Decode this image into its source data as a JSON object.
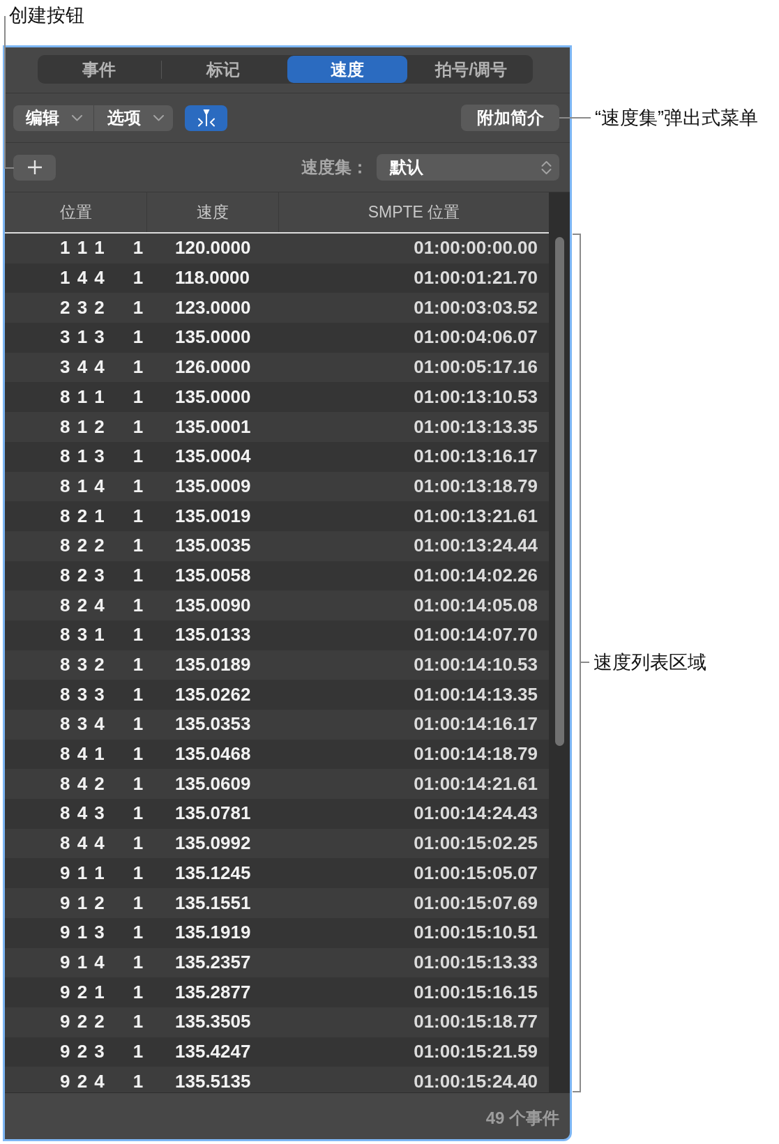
{
  "annotations": [
    {
      "kind": "elbow",
      "text": "创建按钮"
    },
    {
      "kind": "line",
      "text": "“速度集”弹出式菜单"
    },
    {
      "kind": "bracket",
      "text": "速度列表区域"
    }
  ],
  "tabs": [
    {
      "label": "事件",
      "selected": false
    },
    {
      "label": "标记",
      "selected": false
    },
    {
      "label": "速度",
      "selected": true
    },
    {
      "label": "拍号/调号",
      "selected": false
    }
  ],
  "toolbar": {
    "menus": [
      {
        "label": "编辑"
      },
      {
        "label": "选项"
      }
    ],
    "toggle": {
      "on": true
    },
    "info_button": {
      "label": "附加简介"
    }
  },
  "tempo_set": {
    "label": "速度集：",
    "value": "默认"
  },
  "table": {
    "columns": [
      "位置",
      "速度",
      "SMPTE 位置"
    ],
    "rows": [
      {
        "position": "1 1 1",
        "tick": "1",
        "tempo": "120.0000",
        "smpte": "01:00:00:00.00"
      },
      {
        "position": "1 4 4",
        "tick": "1",
        "tempo": "118.0000",
        "smpte": "01:00:01:21.70"
      },
      {
        "position": "2 3 2",
        "tick": "1",
        "tempo": "123.0000",
        "smpte": "01:00:03:03.52"
      },
      {
        "position": "3 1 3",
        "tick": "1",
        "tempo": "135.0000",
        "smpte": "01:00:04:06.07"
      },
      {
        "position": "3 4 4",
        "tick": "1",
        "tempo": "126.0000",
        "smpte": "01:00:05:17.16"
      },
      {
        "position": "8 1 1",
        "tick": "1",
        "tempo": "135.0000",
        "smpte": "01:00:13:10.53"
      },
      {
        "position": "8 1 2",
        "tick": "1",
        "tempo": "135.0001",
        "smpte": "01:00:13:13.35"
      },
      {
        "position": "8 1 3",
        "tick": "1",
        "tempo": "135.0004",
        "smpte": "01:00:13:16.17"
      },
      {
        "position": "8 1 4",
        "tick": "1",
        "tempo": "135.0009",
        "smpte": "01:00:13:18.79"
      },
      {
        "position": "8 2 1",
        "tick": "1",
        "tempo": "135.0019",
        "smpte": "01:00:13:21.61"
      },
      {
        "position": "8 2 2",
        "tick": "1",
        "tempo": "135.0035",
        "smpte": "01:00:13:24.44"
      },
      {
        "position": "8 2 3",
        "tick": "1",
        "tempo": "135.0058",
        "smpte": "01:00:14:02.26"
      },
      {
        "position": "8 2 4",
        "tick": "1",
        "tempo": "135.0090",
        "smpte": "01:00:14:05.08"
      },
      {
        "position": "8 3 1",
        "tick": "1",
        "tempo": "135.0133",
        "smpte": "01:00:14:07.70"
      },
      {
        "position": "8 3 2",
        "tick": "1",
        "tempo": "135.0189",
        "smpte": "01:00:14:10.53"
      },
      {
        "position": "8 3 3",
        "tick": "1",
        "tempo": "135.0262",
        "smpte": "01:00:14:13.35"
      },
      {
        "position": "8 3 4",
        "tick": "1",
        "tempo": "135.0353",
        "smpte": "01:00:14:16.17"
      },
      {
        "position": "8 4 1",
        "tick": "1",
        "tempo": "135.0468",
        "smpte": "01:00:14:18.79"
      },
      {
        "position": "8 4 2",
        "tick": "1",
        "tempo": "135.0609",
        "smpte": "01:00:14:21.61"
      },
      {
        "position": "8 4 3",
        "tick": "1",
        "tempo": "135.0781",
        "smpte": "01:00:14:24.43"
      },
      {
        "position": "8 4 4",
        "tick": "1",
        "tempo": "135.0992",
        "smpte": "01:00:15:02.25"
      },
      {
        "position": "9 1 1",
        "tick": "1",
        "tempo": "135.1245",
        "smpte": "01:00:15:05.07"
      },
      {
        "position": "9 1 2",
        "tick": "1",
        "tempo": "135.1551",
        "smpte": "01:00:15:07.69"
      },
      {
        "position": "9 1 3",
        "tick": "1",
        "tempo": "135.1919",
        "smpte": "01:00:15:10.51"
      },
      {
        "position": "9 1 4",
        "tick": "1",
        "tempo": "135.2357",
        "smpte": "01:00:15:13.33"
      },
      {
        "position": "9 2 1",
        "tick": "1",
        "tempo": "135.2877",
        "smpte": "01:00:15:16.15"
      },
      {
        "position": "9 2 2",
        "tick": "1",
        "tempo": "135.3505",
        "smpte": "01:00:15:18.77"
      },
      {
        "position": "9 2 3",
        "tick": "1",
        "tempo": "135.4247",
        "smpte": "01:00:15:21.59"
      },
      {
        "position": "9 2 4",
        "tick": "1",
        "tempo": "135.5135",
        "smpte": "01:00:15:24.40"
      }
    ]
  },
  "footer": {
    "count": "49 个事件"
  }
}
